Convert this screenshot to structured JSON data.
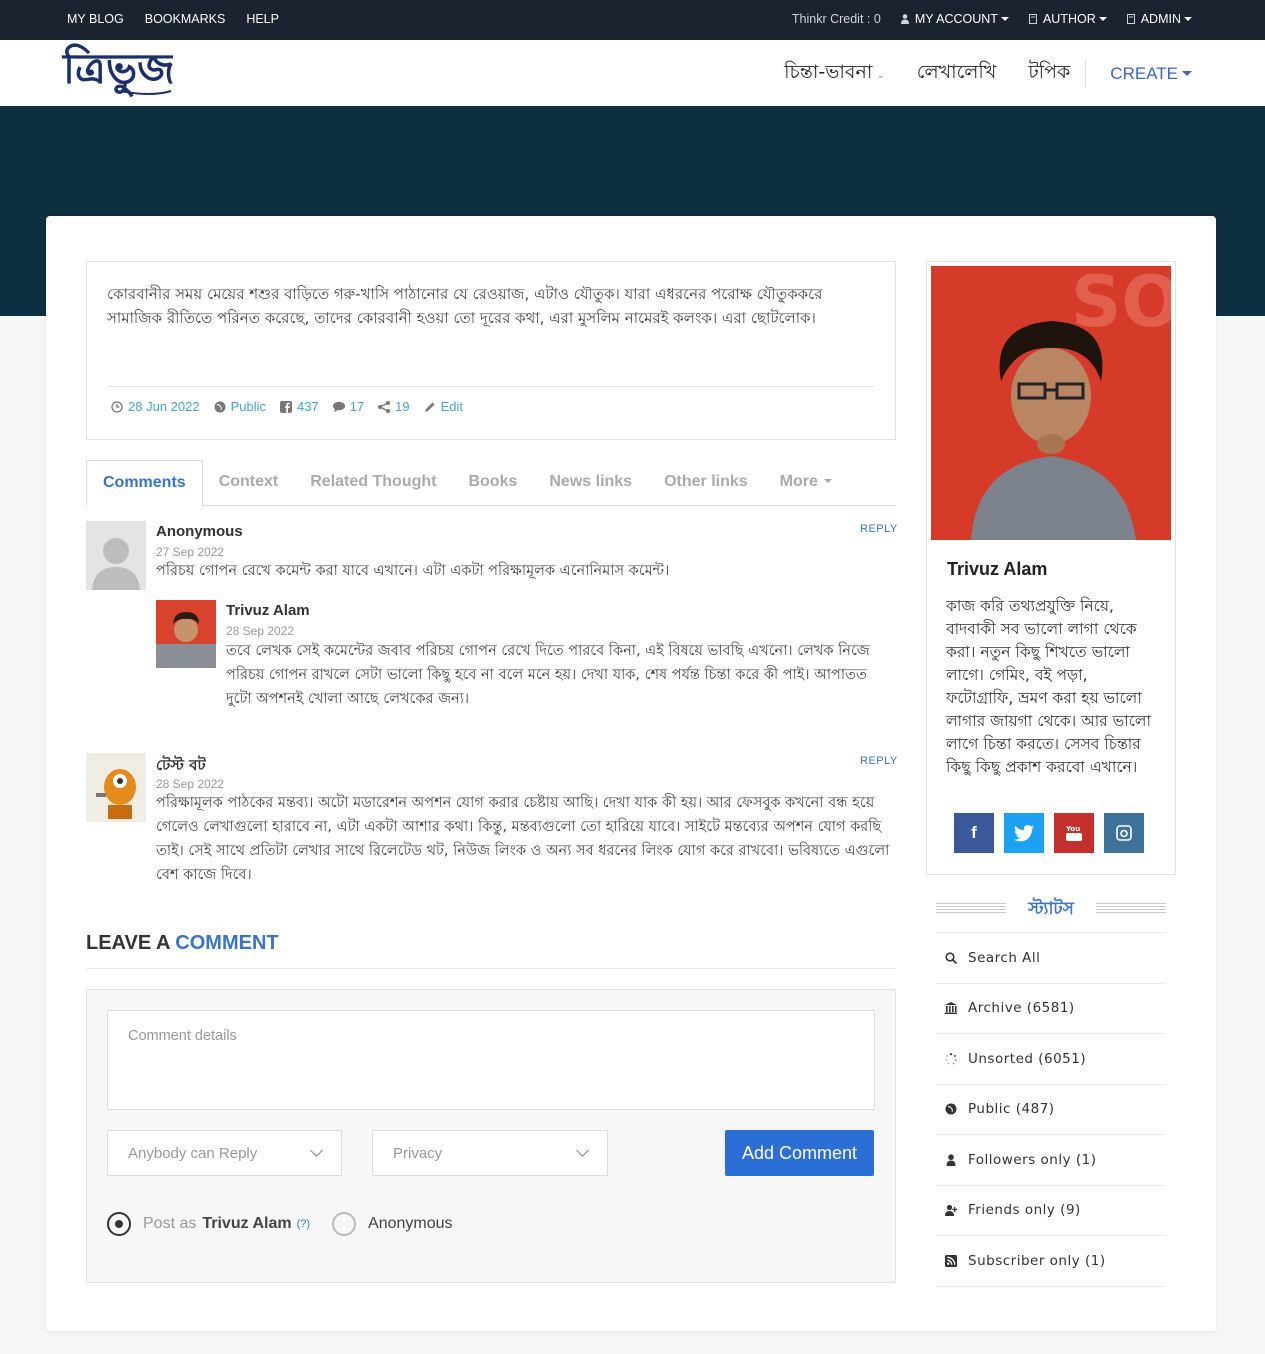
{
  "topbar": {
    "links": [
      "MY BLOG",
      "BOOKMARKS",
      "HELP"
    ],
    "credit": "Thinkr Credit : 0",
    "my_account": "MY ACCOUNT",
    "author": "AUTHOR",
    "admin": "ADMIN"
  },
  "header": {
    "logo_text": "ত্রিভুজ",
    "nav": [
      "চিন্তা-ভাবনা",
      "লেখালেখি",
      "টপিক"
    ],
    "create": "CREATE"
  },
  "thought": {
    "text": "কোরবানীর সময় মেয়ের শশুর বাড়িতে গরু-খাসি পাঠানোর যে রেওয়াজ, এটাও যৌতুক। যারা এধরনের পরোক্ষ যৌতুককরে সামাজিক রীতিতে পরিনত করেছে, তাদের কোরবানী হওয়া তো দূরের কথা, এরা মুসলিম নামেরই কলংক। এরা ছোটলোক।",
    "date": "28 Jun 2022",
    "visibility": "Public",
    "facebook_count": "437",
    "comment_count": "17",
    "share_count": "19",
    "edit_label": "Edit"
  },
  "tabs": [
    "Comments",
    "Context",
    "Related Thought",
    "Books",
    "News links",
    "Other links",
    "More"
  ],
  "comments": [
    {
      "author": "Anonymous",
      "date": "27 Sep 2022",
      "text": "পরিচয় গোপন রেখে কমেন্ট করা যাবে এখানে। এটা একটা পরিক্ষামূলক এনোনিমাস কমেন্ট।",
      "reply_label": "REPLY",
      "reply": {
        "author": "Trivuz Alam",
        "date": "28 Sep 2022",
        "text": "তবে লেখক সেই কমেন্টের জবাব পরিচয় গোপন রেখে দিতে পারবে কিনা, এই বিষয়ে ভাবছি এখনো। লেখক নিজে পরিচয় গোপন রাখলে সেটা ভালো কিছু হবে না বলে মনে হয়। দেখা যাক, শেষ পর্যন্ত চিন্তা করে কী পাই। আপাতত দুটো অপশনই খোলা আছে লেখকের জন্য।"
      }
    },
    {
      "author": "টেস্ট বট",
      "date": "28 Sep 2022",
      "text": "পরিক্ষামূলক পাঠকের মন্তব্য। অটো মডারেশন অপশন যোগ করার চেষ্টায় আছি। দেখা যাক কী হয়। আর ফেসবুক কখনো বন্ধ হয়ে গেলেও লেখাগুলো হারাবে না, এটা একটা আশার কথা। কিন্তু, মন্তব্যগুলো তো হারিয়ে যাবে। সাইটে মন্তব্যের অপশন যোগ করছি তাই। সেই সাথে প্রতিটা লেখার সাথে রিলেটেড থট, নিউজ লিংক ও অন্য সব ধরনের লিংক যোগ করে রাখবো। ভবিষ্যতে এগুলো বেশ কাজে দিবে।",
      "reply_label": "REPLY"
    }
  ],
  "leave_comment": {
    "title_part1": "LEAVE A ",
    "title_part2": "COMMENT",
    "placeholder": "Comment details",
    "reply_select": "Anybody can Reply",
    "privacy_select": "Privacy",
    "submit": "Add Comment",
    "post_as_label": "Post as",
    "post_as_name": "Trivuz Alam",
    "help": "(?)",
    "anonymous": "Anonymous"
  },
  "profile": {
    "name": "Trivuz Alam",
    "bio": "কাজ করি তথ্যপ্রযুক্তি নিয়ে, বাদবাকী সব ভালো লাগা থেকে করা। নতুন কিছু শিখতে ভালো লাগে। গেমিং, বই পড়া, ফটোগ্রাফি, ভ্রমণ করা হয় ভালো লাগার জায়গা থেকে। আর ভালো লাগে চিন্তা করতে। সেসব চিন্তার কিছু কিছু প্রকাশ করবো এখানে।",
    "social_colors": [
      "#3b5998",
      "#1da1f2",
      "#c4302b",
      "#3f729b"
    ]
  },
  "stats": {
    "title": "স্ট্যাটস",
    "items": [
      {
        "label": "Search All",
        "icon": "search-icon"
      },
      {
        "label": "Archive (6581)",
        "icon": "archive-icon"
      },
      {
        "label": "Unsorted (6051)",
        "icon": "spinner-icon"
      },
      {
        "label": "Public (487)",
        "icon": "globe-icon"
      },
      {
        "label": "Followers only (1)",
        "icon": "user-icon"
      },
      {
        "label": "Friends only (9)",
        "icon": "user-plus-icon"
      },
      {
        "label": "Subscriber only (1)",
        "icon": "rss-icon"
      }
    ]
  }
}
